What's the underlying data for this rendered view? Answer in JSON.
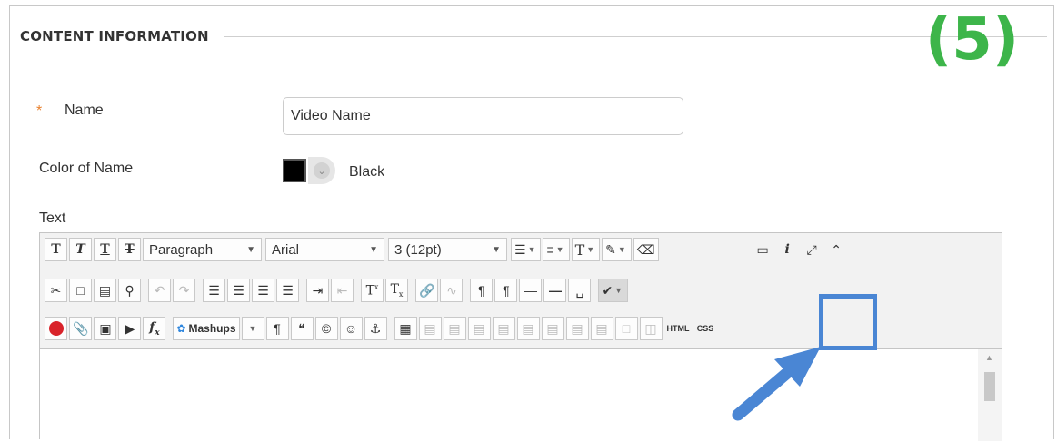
{
  "annotation": {
    "step": "(5)",
    "highlight_color": "#4a86d4",
    "step_color": "#3db54a"
  },
  "section": {
    "title": "CONTENT INFORMATION"
  },
  "name_field": {
    "required_mark": "*",
    "label": "Name",
    "value": "Video Name"
  },
  "color_field": {
    "label": "Color of Name",
    "swatch": "#000000",
    "value": "Black"
  },
  "text_field": {
    "label": "Text"
  },
  "toolbar": {
    "format_select": "Paragraph",
    "font_select": "Arial",
    "size_select": "3 (12pt)",
    "mashups": "Mashups",
    "html_button": "HTML",
    "css_button": "CSS"
  }
}
